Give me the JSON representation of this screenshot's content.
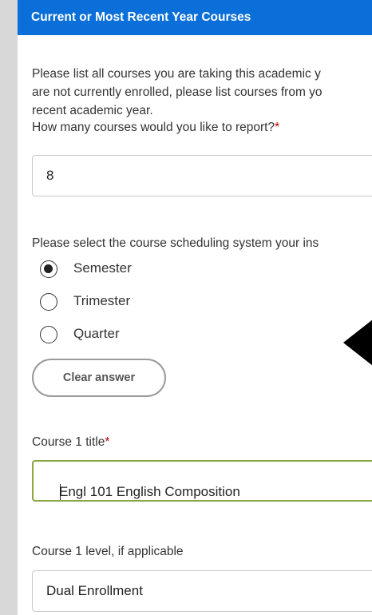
{
  "section": {
    "title": "Current or Most Recent Year Courses"
  },
  "intro": {
    "line1": "Please list all courses you are taking this academic y",
    "line2": "are not currently enrolled, please list courses from yo",
    "line3": "recent academic year."
  },
  "count_question": {
    "label": "How many courses would you like to report?",
    "required_mark": "*",
    "value": "8"
  },
  "scheduling": {
    "question": "Please select the course scheduling system your ins",
    "options": [
      {
        "label": "Semester",
        "selected": true
      },
      {
        "label": "Trimester",
        "selected": false
      },
      {
        "label": "Quarter",
        "selected": false
      }
    ],
    "clear_label": "Clear answer"
  },
  "course1_title": {
    "label": "Course 1 title",
    "required_mark": "*",
    "value": "Engl 101 English Composition"
  },
  "course1_level": {
    "label": "Course 1 level, if applicable",
    "value": "Dual Enrollment"
  },
  "colors": {
    "header": "#0a6fd8",
    "required": "#c00000",
    "active_border": "#8aa542"
  },
  "icons": {
    "pointer": "left-arrow-icon"
  }
}
